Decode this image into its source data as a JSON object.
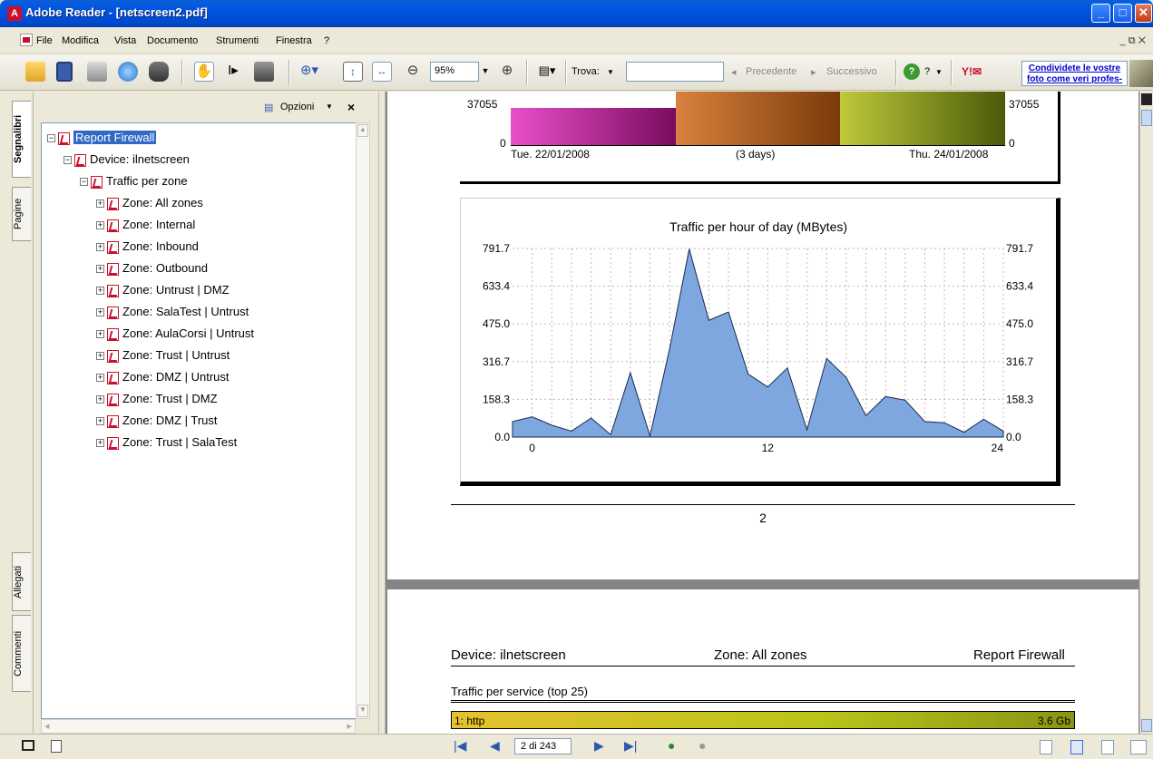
{
  "window": {
    "title": "Adobe Reader - [netscreen2.pdf]"
  },
  "menu": {
    "items": [
      "File",
      "Modifica",
      "Vista",
      "Documento",
      "Strumenti",
      "Finestra",
      "?"
    ],
    "mdi_controls": "_ ⧉ ✕"
  },
  "toolbar": {
    "zoom": "95%",
    "find_label": "Trova:",
    "find_value": "",
    "prev_label": "Precedente",
    "next_label": "Successivo",
    "help_label": "?",
    "ad_text": "Condividete le vostre foto come veri profes-"
  },
  "side_tabs": {
    "bookmarks": "Segnalibri",
    "pages": "Pagine",
    "attachments": "Allegati",
    "comments": "Commenti"
  },
  "bookmarks": {
    "options_label": "Opzioni",
    "tree": [
      {
        "label": "Report Firewall",
        "level": 0,
        "expanded": true,
        "selected": true
      },
      {
        "label": "Device: ilnetscreen",
        "level": 1,
        "expanded": true
      },
      {
        "label": "Traffic per zone",
        "level": 2,
        "expanded": true
      },
      {
        "label": "Zone: All zones",
        "level": 3
      },
      {
        "label": "Zone: Internal",
        "level": 3
      },
      {
        "label": "Zone: Inbound",
        "level": 3
      },
      {
        "label": "Zone: Outbound",
        "level": 3
      },
      {
        "label": "Zone: Untrust | DMZ",
        "level": 3
      },
      {
        "label": "Zone: SalaTest | Untrust",
        "level": 3
      },
      {
        "label": "Zone: AulaCorsi | Untrust",
        "level": 3
      },
      {
        "label": "Zone: Trust | Untrust",
        "level": 3
      },
      {
        "label": "Zone: DMZ | Untrust",
        "level": 3
      },
      {
        "label": "Zone: Trust | DMZ",
        "level": 3
      },
      {
        "label": "Zone: DMZ | Trust",
        "level": 3
      },
      {
        "label": "Zone: Trust | SalaTest",
        "level": 3
      }
    ]
  },
  "doc": {
    "top_chart": {
      "ymax": "37055",
      "ymin": "0",
      "start": "Tue. 22/01/2008",
      "middle": "(3 days)",
      "end": "Thu. 24/01/2008",
      "colors": [
        "#c02a9c",
        "#b86018",
        "#8a9a14"
      ]
    },
    "page_number": "2",
    "header": {
      "device": "Device: ilnetscreen",
      "zone": "Zone: All zones",
      "report": "Report Firewall"
    },
    "section_title": "Traffic per service (top 25)",
    "service_row": {
      "label": "1: http",
      "value": "3.6 Gb"
    }
  },
  "chart_data": {
    "type": "area",
    "title": "Traffic per hour of day (MBytes)",
    "ylim": [
      0,
      791.7
    ],
    "yticks": [
      "0.0",
      "158.3",
      "316.7",
      "475.0",
      "633.4",
      "791.7"
    ],
    "xticks": [
      {
        "x": 0,
        "label": "0"
      },
      {
        "x": 12,
        "label": "12"
      },
      {
        "x": 24,
        "label": "24"
      }
    ],
    "grid": true,
    "color": "#7ea7e0",
    "x": [
      -1,
      0,
      1,
      2,
      3,
      4,
      5,
      6,
      7,
      8,
      9,
      10,
      11,
      12,
      13,
      14,
      15,
      16,
      17,
      18,
      19,
      20,
      21,
      22,
      23,
      24
    ],
    "values": [
      65,
      85,
      50,
      25,
      80,
      10,
      270,
      5,
      370,
      790,
      490,
      525,
      265,
      210,
      290,
      30,
      330,
      250,
      90,
      170,
      155,
      65,
      60,
      20,
      75,
      25
    ]
  },
  "status": {
    "page_field": "2 di 243"
  }
}
